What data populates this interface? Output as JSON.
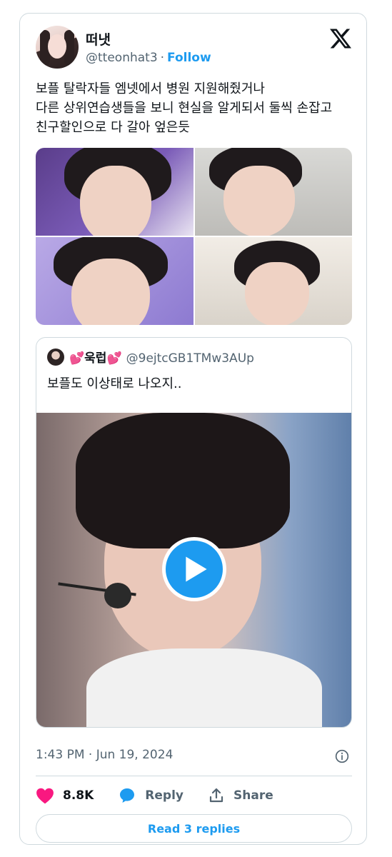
{
  "author": {
    "name": "떠냇",
    "handle": "@tteonhat3",
    "separator": "·",
    "follow_label": "Follow"
  },
  "tweet": {
    "text": "보플 탈락자들 엠넷에서 병원 지원해줬거나\n다른 상위연습생들을 보니 현실을 알게되서 둘씩 손잡고\n친구할인으로 다 갈아 엎은듯",
    "media_count": 4
  },
  "quoted": {
    "name": "💕욱럽💕",
    "handle": "@9ejtcGB1TMw3AUp",
    "text": "보플도 이상태로 나오지..",
    "media_type": "video"
  },
  "meta": {
    "timestamp": "1:43 PM · Jun 19, 2024"
  },
  "actions": {
    "likes": "8.8K",
    "reply_label": "Reply",
    "share_label": "Share"
  },
  "read_replies_label": "Read 3 replies",
  "colors": {
    "accent": "#1d9bf0",
    "like": "#f91880",
    "secondary_text": "#536471",
    "border": "#cfd9de"
  },
  "icons": [
    "x-logo-icon",
    "play-icon",
    "info-icon",
    "heart-icon",
    "reply-bubble-icon",
    "share-icon"
  ]
}
